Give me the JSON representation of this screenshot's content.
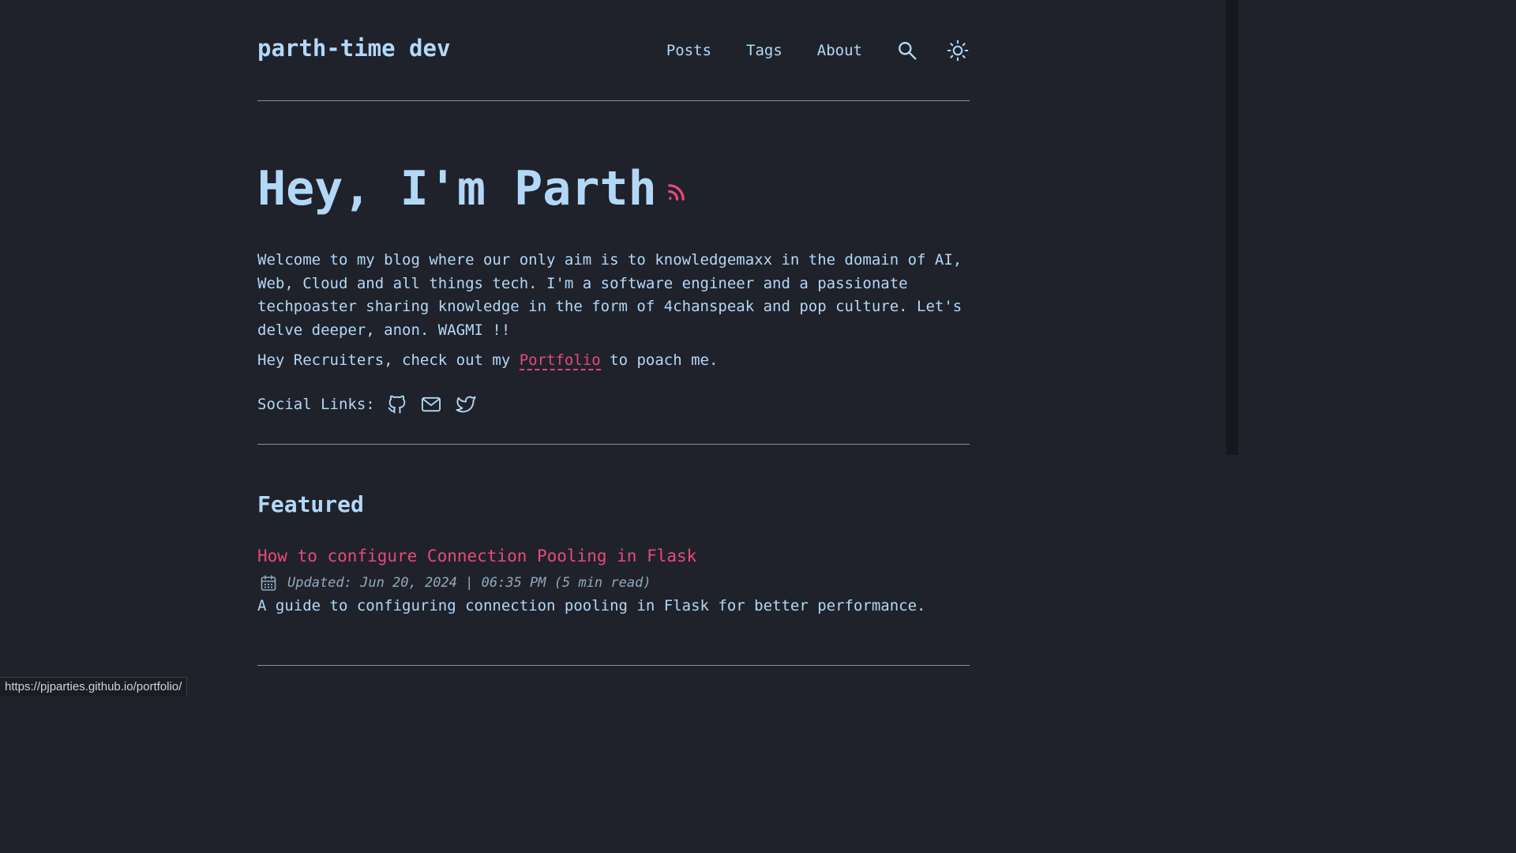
{
  "site": {
    "title": "parth-time dev"
  },
  "nav": {
    "items": [
      {
        "label": "Posts"
      },
      {
        "label": "Tags"
      },
      {
        "label": "About"
      }
    ],
    "search_icon": "search-icon",
    "theme_icon": "sun-icon"
  },
  "hero": {
    "heading": "Hey, I'm Parth",
    "rss_icon": "rss-icon"
  },
  "intro": {
    "text": "Welcome to my blog where our only aim is to knowledgemaxx in the domain of AI, Web, Cloud and all things tech. I'm a software engineer and a passionate techpoaster sharing knowledge in the form of 4chanspeak and pop culture. Let's delve deeper, anon. WAGMI !!"
  },
  "recruit": {
    "before": "Hey Recruiters, check out my ",
    "link_label": "Portfolio",
    "after": " to poach me."
  },
  "social": {
    "label": "Social Links:",
    "icons": [
      "github-icon",
      "mail-icon",
      "twitter-icon"
    ]
  },
  "featured": {
    "heading": "Featured",
    "posts": [
      {
        "title": "How to configure Connection Pooling in Flask",
        "meta": "Updated: Jun 20, 2024 | 06:35 PM (5 min read)",
        "description": "A guide to configuring connection pooling in Flask for better performance."
      }
    ]
  },
  "status_bar": {
    "url": "https://pjparties.github.io/portfolio/"
  },
  "colors": {
    "background": "#1f222b",
    "text": "#b3d8f7",
    "accent": "#e7497a",
    "muted": "#93a9bd",
    "border": "#8a8f99"
  }
}
